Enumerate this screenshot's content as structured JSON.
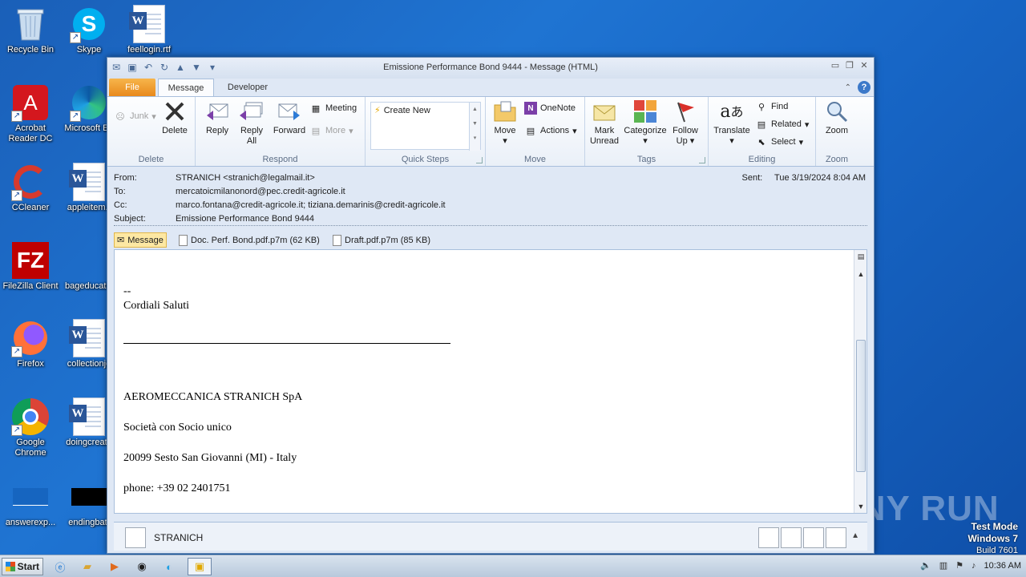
{
  "desktop": {
    "icons": [
      {
        "label": "Recycle Bin"
      },
      {
        "label": "Skype"
      },
      {
        "label": "feellogin.rtf"
      },
      {
        "label": "Acrobat Reader DC"
      },
      {
        "label": "Microsoft Ed"
      },
      {
        "label": "CCleaner"
      },
      {
        "label": "appleitem.r"
      },
      {
        "label": "FileZilla Client"
      },
      {
        "label": "bageducatio"
      },
      {
        "label": "Firefox"
      },
      {
        "label": "collectionjo"
      },
      {
        "label": "Google Chrome"
      },
      {
        "label": "doingcreate"
      },
      {
        "label": "answerexp..."
      },
      {
        "label": "endingbatt"
      }
    ]
  },
  "window": {
    "title": "Emissione Performance Bond 9444 - Message (HTML)"
  },
  "tabs": {
    "file": "File",
    "message": "Message",
    "developer": "Developer"
  },
  "ribbon": {
    "delete_group": {
      "label": "Delete",
      "junk": "Junk",
      "delete": "Delete"
    },
    "respond_group": {
      "label": "Respond",
      "reply": "Reply",
      "reply_all": "Reply All",
      "forward": "Forward",
      "meeting": "Meeting",
      "more": "More"
    },
    "quicksteps_group": {
      "label": "Quick Steps",
      "create_new": "Create New"
    },
    "move_group": {
      "label": "Move",
      "move": "Move",
      "onenote": "OneNote",
      "actions": "Actions"
    },
    "tags_group": {
      "label": "Tags",
      "mark_unread": "Mark Unread",
      "categorize": "Categorize",
      "follow_up": "Follow Up"
    },
    "editing_group": {
      "label": "Editing",
      "translate": "Translate",
      "find": "Find",
      "related": "Related",
      "select": "Select"
    },
    "zoom_group": {
      "label": "Zoom",
      "zoom": "Zoom"
    }
  },
  "headers": {
    "from_label": "From:",
    "from_value": "STRANICH <stranich@legalmail.it>",
    "to_label": "To:",
    "to_value": "mercatoicmilanonord@pec.credit-agricole.it",
    "cc_label": "Cc:",
    "cc_value": "marco.fontana@credit-agricole.it; tiziana.demarinis@credit-agricole.it",
    "subject_label": "Subject:",
    "subject_value": "Emissione Performance Bond 9444",
    "sent_label": "Sent:",
    "sent_value": "Tue 3/19/2024 8:04 AM"
  },
  "attachments": [
    {
      "name": "Message"
    },
    {
      "name": "Doc. Perf. Bond.pdf.p7m (62 KB)"
    },
    {
      "name": "Draft.pdf.p7m (85 KB)"
    }
  ],
  "body": {
    "sig_dash": "--",
    "regards": "Cordiali Saluti",
    "company": "AEROMECCANICA STRANICH SpA",
    "line2": "Società con Socio unico",
    "address": "20099 Sesto San Giovanni (MI) - Italy",
    "phone": "phone: +39 02 2401751"
  },
  "people_pane": {
    "name": "STRANICH"
  },
  "taskbar": {
    "start": "Start",
    "time": "10:36 AM"
  },
  "watermark": {
    "line1": "Test Mode",
    "line2": "Windows 7",
    "line3": "Build 7601",
    "brand": "ANY RUN"
  }
}
